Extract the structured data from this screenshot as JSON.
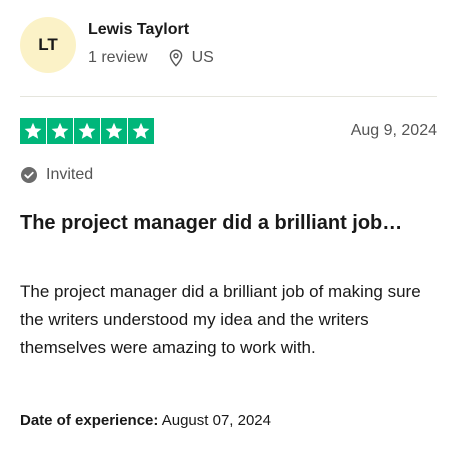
{
  "reviewer": {
    "initials": "LT",
    "name": "Lewis Taylort",
    "review_count": "1 review",
    "country": "US",
    "avatar_color": "#fbf2c7"
  },
  "review": {
    "rating": 5,
    "max_rating": 5,
    "star_color": "#00b67a",
    "date": "Aug 9, 2024",
    "invited_label": "Invited",
    "title": "The project manager did a brilliant job…",
    "body": "The project manager did a brilliant job of making sure the writers understood my idea and the writers themselves were amazing to work with.",
    "experience_label": "Date of experience:",
    "experience_date": " August 07, 2024"
  },
  "icons": {
    "location": "location-pin-icon",
    "invited": "check-circle-icon",
    "star": "star-icon"
  }
}
